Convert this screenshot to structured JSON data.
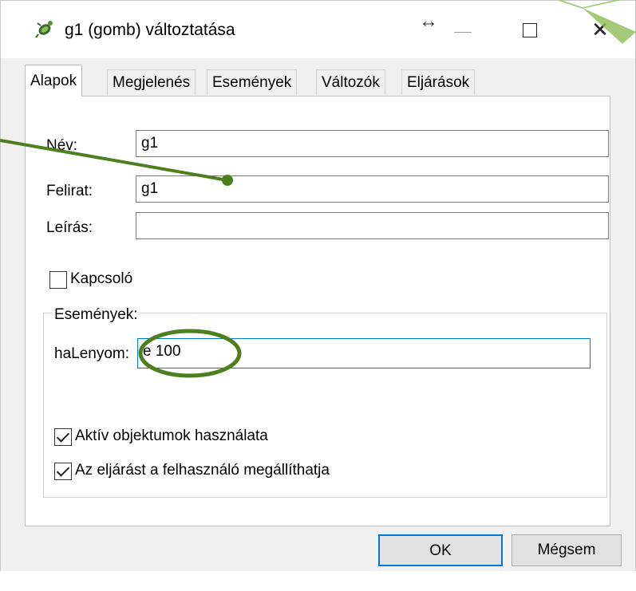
{
  "window": {
    "title": "g1 (gomb) változtatása",
    "icons": [
      "app-icon",
      "resize-horizontal-icon",
      "minimize-icon",
      "maximize-icon",
      "close-icon"
    ],
    "close_glyph": "✕",
    "resize_glyph": "↔"
  },
  "tabs": [
    "Alapok",
    "Megjelenés",
    "Események",
    "Változók",
    "Eljárások"
  ],
  "active_tab": "Alapok",
  "form": {
    "name_label": "Név:",
    "name_value": "g1",
    "caption_label": "Felirat:",
    "caption_value": "g1",
    "description_label": "Leírás:",
    "description_value": "",
    "toggle_label": "Kapcsoló",
    "toggle_checked": false
  },
  "events": {
    "group_label": "Események:",
    "onpress_label": "haLenyom:",
    "onpress_value": "e 100",
    "active_objects_label": "Aktív objektumok használata",
    "active_objects_checked": true,
    "user_stop_label": "Az eljárást a felhasználó megállíthatja",
    "user_stop_checked": true
  },
  "buttons": {
    "ok": "OK",
    "cancel": "Mégsem"
  },
  "annotation_color": "#4e7f1e",
  "accent_color": "#0078d7"
}
